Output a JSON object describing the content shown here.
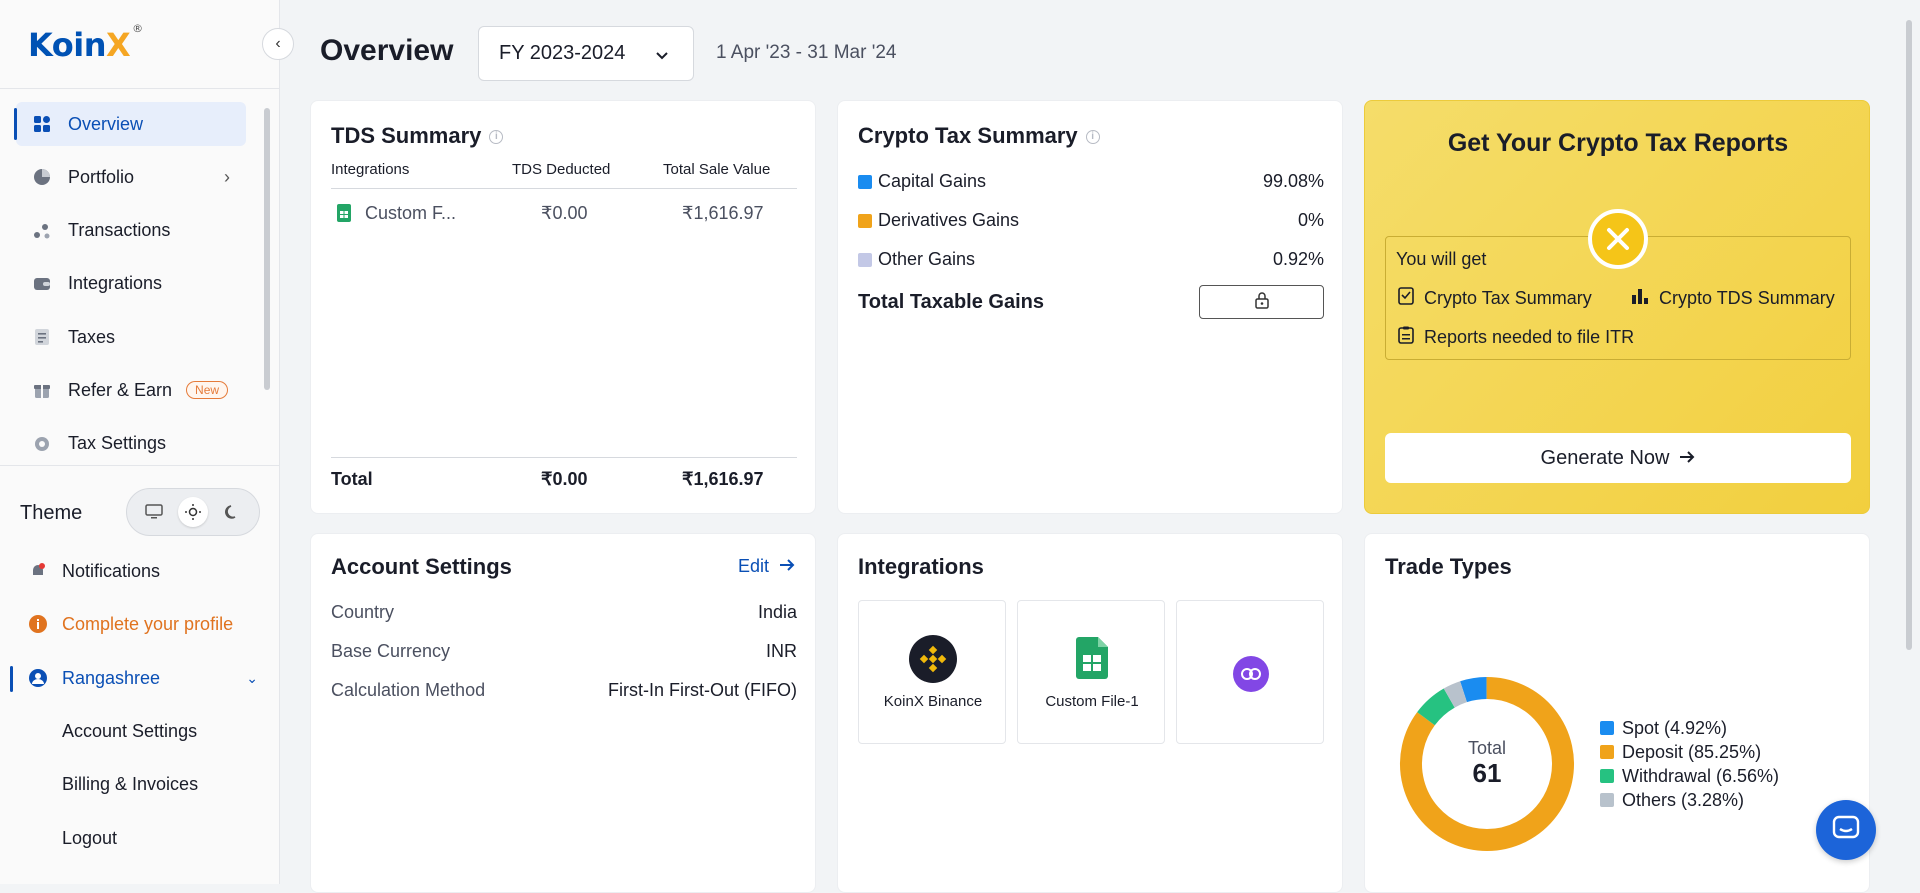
{
  "brand": {
    "logo_text_main": "Koin",
    "logo_text_x": "X",
    "logo_mark": "®"
  },
  "sidebar": {
    "items": [
      {
        "label": "Overview",
        "icon": "grid-icon",
        "active": true
      },
      {
        "label": "Portfolio",
        "icon": "pie-chart-icon",
        "has_chevron": true
      },
      {
        "label": "Transactions",
        "icon": "transfer-icon"
      },
      {
        "label": "Integrations",
        "icon": "wallet-icon"
      },
      {
        "label": "Taxes",
        "icon": "document-icon"
      },
      {
        "label": "Refer & Earn",
        "icon": "gift-icon",
        "badge": "New"
      },
      {
        "label": "Tax Settings",
        "icon": "gear-icon"
      }
    ],
    "theme_label": "Theme",
    "notifications": "Notifications",
    "complete_profile": "Complete your profile",
    "user_name": "Rangashree",
    "user_menu": [
      "Account Settings",
      "Billing & Invoices",
      "Logout"
    ]
  },
  "header": {
    "title": "Overview",
    "fy_selected": "FY 2023-2024",
    "date_range": "1 Apr '23 - 31 Mar '24"
  },
  "tds": {
    "title": "TDS Summary",
    "columns": [
      "Integrations",
      "TDS Deducted",
      "Total Sale Value"
    ],
    "rows": [
      {
        "name": "Custom F...",
        "tds": "₹0.00",
        "sale": "₹1,616.97"
      }
    ],
    "total_label": "Total",
    "total_tds": "₹0.00",
    "total_sale": "₹1,616.97"
  },
  "crypto_tax": {
    "title": "Crypto Tax Summary",
    "items": [
      {
        "label": "Capital Gains",
        "value": "99.08%",
        "color": "#1a8cf0"
      },
      {
        "label": "Derivatives Gains",
        "value": "0%",
        "color": "#f0a31a"
      },
      {
        "label": "Other Gains",
        "value": "0.92%",
        "color": "#c3c8e6"
      }
    ],
    "total_label": "Total Taxable Gains"
  },
  "reports": {
    "title": "Get Your Crypto Tax Reports",
    "you_will_get": "You will get",
    "item1": "Crypto Tax Summary",
    "item2": "Crypto TDS Summary",
    "item3": "Reports needed to file ITR",
    "button": "Generate Now"
  },
  "account": {
    "title": "Account Settings",
    "edit": "Edit",
    "rows": [
      {
        "label": "Country",
        "value": "India"
      },
      {
        "label": "Base Currency",
        "value": "INR"
      },
      {
        "label": "Calculation Method",
        "value": "First-In First-Out (FIFO)"
      }
    ]
  },
  "integrations": {
    "title": "Integrations",
    "tiles": [
      {
        "label": "KoinX Binance",
        "icon": "binance-icon"
      },
      {
        "label": "Custom File-1",
        "icon": "spreadsheet-icon"
      },
      {
        "label": "",
        "icon": "polygon-icon"
      }
    ]
  },
  "trade_types": {
    "title": "Trade Types",
    "total_label": "Total",
    "total_value": "61"
  },
  "chart_data": {
    "type": "pie",
    "categories": [
      "Spot",
      "Deposit",
      "Withdrawal",
      "Others"
    ],
    "values": [
      4.92,
      85.25,
      6.56,
      3.28
    ],
    "legend_labels": [
      "Spot (4.92%)",
      "Deposit (85.25%)",
      "Withdrawal (6.56%)",
      "Others (3.28%)"
    ],
    "colors": [
      "#1a8cf0",
      "#f0a31a",
      "#26c281",
      "#b8c2cc"
    ],
    "legend_position": "right"
  }
}
